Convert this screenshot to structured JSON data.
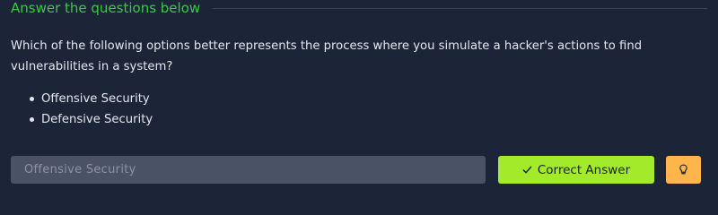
{
  "section": {
    "heading": "Answer the questions below"
  },
  "question": {
    "text": "Which of the following options better represents the process where you simulate a hacker's actions to find vulnerabilities in a system?",
    "options": [
      "Offensive Security",
      "Defensive Security"
    ]
  },
  "answer": {
    "value": "Offensive Security",
    "submit_label": "Correct Answer",
    "submit_icon": "check-icon",
    "hint_icon": "lightbulb-icon"
  },
  "colors": {
    "heading": "#3ec54a",
    "background": "#1c2538",
    "correct_button": "#a3ea2a",
    "hint_button": "#ffb54a",
    "input": "#4a5366"
  }
}
